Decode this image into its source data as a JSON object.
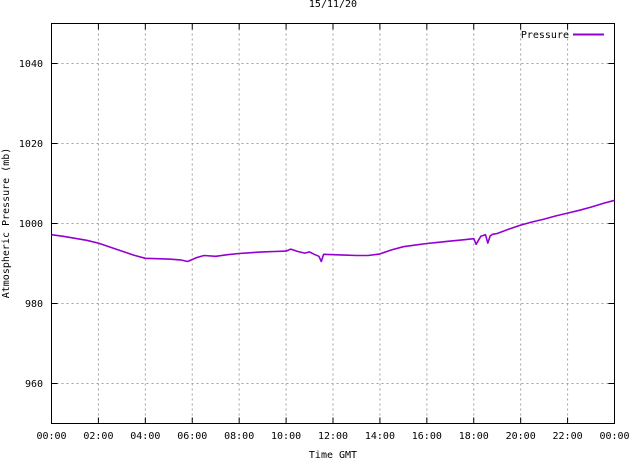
{
  "chart_data": {
    "type": "line",
    "title": "15/11/20",
    "xlabel": "Time GMT",
    "ylabel": "Atmospheric Pressure (mb)",
    "xlim": [
      0,
      24
    ],
    "ylim": [
      950,
      1050
    ],
    "x_ticks": [
      {
        "value": 0,
        "label": "00:00"
      },
      {
        "value": 2,
        "label": "02:00"
      },
      {
        "value": 4,
        "label": "04:00"
      },
      {
        "value": 6,
        "label": "06:00"
      },
      {
        "value": 8,
        "label": "08:00"
      },
      {
        "value": 10,
        "label": "10:00"
      },
      {
        "value": 12,
        "label": "12:00"
      },
      {
        "value": 14,
        "label": "14:00"
      },
      {
        "value": 16,
        "label": "16:00"
      },
      {
        "value": 18,
        "label": "18:00"
      },
      {
        "value": 20,
        "label": "20:00"
      },
      {
        "value": 22,
        "label": "22:00"
      },
      {
        "value": 24,
        "label": "00:00"
      }
    ],
    "y_ticks": [
      {
        "value": 960,
        "label": "960"
      },
      {
        "value": 980,
        "label": "980"
      },
      {
        "value": 1000,
        "label": "1000"
      },
      {
        "value": 1020,
        "label": "1020"
      },
      {
        "value": 1040,
        "label": "1040"
      }
    ],
    "grid": true,
    "legend_position": "top-right",
    "series": [
      {
        "name": "Pressure",
        "color": "#9400d3",
        "x": [
          0,
          0.5,
          1,
          1.5,
          2,
          2.5,
          3,
          3.5,
          4,
          4.5,
          5,
          5.5,
          5.8,
          6,
          6.2,
          6.5,
          7,
          7.5,
          8,
          8.5,
          9,
          9.5,
          10,
          10.2,
          10.5,
          10.8,
          11,
          11.2,
          11.4,
          11.5,
          11.6,
          12,
          12.5,
          13,
          13.5,
          14,
          14.5,
          15,
          15.5,
          16,
          16.5,
          17,
          17.5,
          18,
          18.1,
          18.3,
          18.5,
          18.6,
          18.7,
          18.8,
          19,
          19.5,
          20,
          20.5,
          21,
          21.5,
          22,
          22.5,
          23,
          23.5,
          24
        ],
        "y": [
          997.2,
          996.8,
          996.3,
          995.8,
          995.1,
          994.1,
          993.1,
          992.1,
          991.3,
          991.2,
          991.1,
          990.9,
          990.5,
          991.0,
          991.5,
          992.0,
          991.8,
          992.2,
          992.5,
          992.7,
          992.9,
          993.0,
          993.1,
          993.6,
          993.0,
          992.6,
          992.9,
          992.3,
          991.8,
          990.5,
          992.3,
          992.2,
          992.1,
          992.0,
          992.0,
          992.4,
          993.4,
          994.2,
          994.6,
          995.0,
          995.3,
          995.6,
          995.9,
          996.2,
          994.8,
          996.8,
          997.2,
          995.1,
          996.9,
          997.3,
          997.5,
          998.6,
          999.6,
          1000.4,
          1001.1,
          1001.9,
          1002.6,
          1003.3,
          1004.1,
          1005.0,
          1005.8
        ]
      }
    ]
  }
}
